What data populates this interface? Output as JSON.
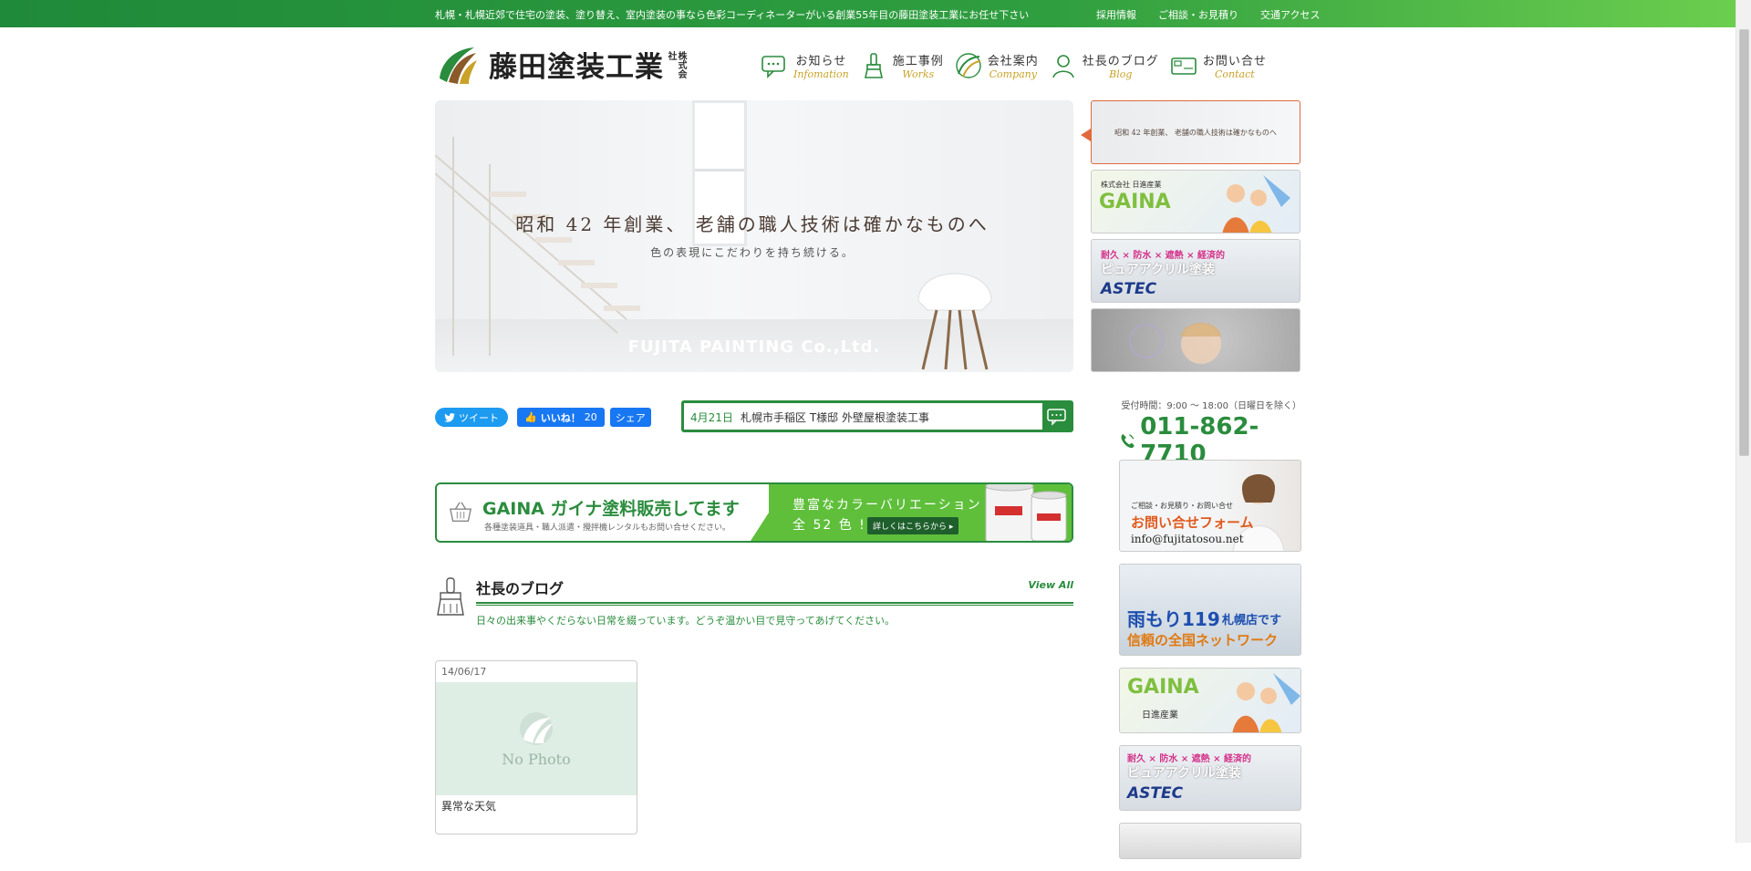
{
  "topbar": {
    "message": "札幌・札幌近郊で住宅の塗装、塗り替え、室内塗装の事なら色彩コーディネーターがいる創業55年目の藤田塗装工業にお任せ下さい",
    "links": [
      "採用情報",
      "ご相談・お見積り",
      "交通アクセス"
    ]
  },
  "logo": {
    "name": "藤田塗装工業",
    "corp": "株式会社"
  },
  "nav": [
    {
      "jp": "お知らせ",
      "en": "Infomation"
    },
    {
      "jp": "施工事例",
      "en": "Works"
    },
    {
      "jp": "会社案内",
      "en": "Company"
    },
    {
      "jp": "社長のブログ",
      "en": "Blog"
    },
    {
      "jp": "お問い合せ",
      "en": "Contact"
    }
  ],
  "hero": {
    "headline": "昭和 42 年創業、 老舗の職人技術は確かなものへ",
    "subline": "色の表現にこだわりを持ち続ける。",
    "brand": "FUJITA PAINTING Co.,Ltd."
  },
  "thumbs": [
    {
      "label": "昭和 42 年創業、 老舗の職人技術は確かなものへ"
    },
    {
      "label": "GAINA",
      "sub": "株式会社 日進産業"
    },
    {
      "label": "ピュアアクリル塗装",
      "sub": "耐久 × 防水 × 遮熱 × 経済的",
      "brand": "ASTEC"
    },
    {
      "label": ""
    }
  ],
  "social": {
    "tweet": "ツイート",
    "like": "いいね！",
    "like_count": "20",
    "share": "シェア"
  },
  "news": {
    "date": "4月21日",
    "title": "札幌市手稲区 T様邸 外壁屋根塗装工事"
  },
  "phone": {
    "hours": "受付時間：9:00 〜 18:00（日曜日を除く）",
    "number": "011-862-7710"
  },
  "banner": {
    "title": "GAINA ガイナ塗料販売してます",
    "sub": "各種塗装道具・職人派遣・攪拌機レンタルもお問い合せください。",
    "right1": "豊富なカラーバリエーション",
    "right2": "全 52 色 !!",
    "cta": "詳しくはこちらから ▸"
  },
  "blog": {
    "title": "社長のブログ",
    "view_all": "View All",
    "desc": "日々の出来事やくだらない日常を綴っています。どうぞ温かい目で見守ってあげてください。",
    "posts": [
      {
        "date": "14/06/17",
        "image": "No Photo",
        "title": "異常な天気"
      }
    ]
  },
  "side": {
    "contact_small": "ご相談・お見積り・お問い合せ",
    "contact_big": "お問い合せフォーム",
    "email": "info@fujitatosou.net",
    "amamori_big": "雨もり119",
    "amamori_small": "札幌店です",
    "amamori_sub": "信頼の全国ネットワーク",
    "gaina": "GAINA",
    "gaina_sub": "日進産業",
    "astec_top": "耐久 × 防水 × 遮熱 × 経済的",
    "astec_mid": "ピュアアクリル塗装",
    "astec_brand": "ASTEC"
  },
  "colors": {
    "brand_green": "#2a8c3d",
    "accent_orange": "#e06a3b",
    "gold": "#c9a227"
  }
}
